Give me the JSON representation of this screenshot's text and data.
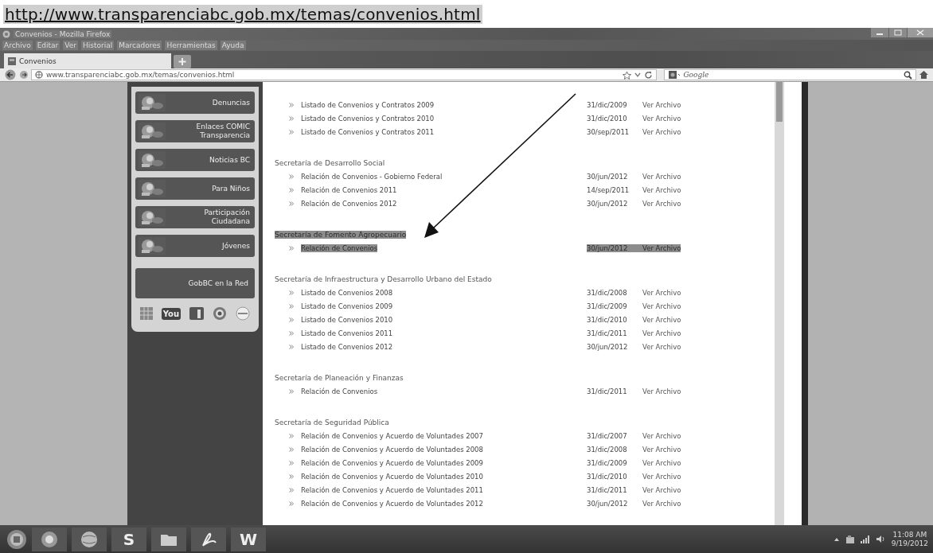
{
  "header_url": "http://www.transparenciabc.gob.mx/temas/convenios.html",
  "window": {
    "title": "Convenios - Mozilla Firefox"
  },
  "menu": [
    "Archivo",
    "Editar",
    "Ver",
    "Historial",
    "Marcadores",
    "Herramientas",
    "Ayuda"
  ],
  "tabs": [
    {
      "label": "Convenios",
      "selected": true
    }
  ],
  "address": "www.transparenciabc.gob.mx/temas/convenios.html",
  "search": {
    "placeholder": "Google"
  },
  "sidebar": {
    "items": [
      {
        "lines": [
          "Denuncias"
        ]
      },
      {
        "lines": [
          "Enlaces COMIC",
          "Transparencia"
        ]
      },
      {
        "lines": [
          "Noticias BC"
        ]
      },
      {
        "lines": [
          "Para Niños"
        ]
      },
      {
        "lines": [
          "Participación",
          "Ciudadana"
        ]
      },
      {
        "lines": [
          "Jóvenes"
        ]
      }
    ],
    "network_heading": "GobBC en la Red",
    "social": [
      {
        "kind": "grid"
      },
      {
        "kind": "video",
        "label": "You"
      },
      {
        "kind": "square"
      },
      {
        "kind": "circle"
      },
      {
        "kind": "disc"
      }
    ]
  },
  "sections": [
    {
      "items": [
        {
          "label": "Listado de Convenios y Contratos 2009",
          "date": "31/dic/2009",
          "link": "Ver Archivo",
          "highlighted": false
        },
        {
          "label": "Listado de Convenios y Contratos 2010",
          "date": "31/dic/2010",
          "link": "Ver Archivo",
          "highlighted": false
        },
        {
          "label": "Listado de Convenios y Contratos 2011",
          "date": "30/sep/2011",
          "link": "Ver Archivo",
          "highlighted": false
        }
      ]
    },
    {
      "title": "Secretaría de Desarrollo Social",
      "highlighted": false,
      "items": [
        {
          "label": "Relación de Convenios - Gobierno Federal",
          "date": "30/jun/2012",
          "link": "Ver Archivo",
          "highlighted": false
        },
        {
          "label": "Relación de Convenios 2011",
          "date": "14/sep/2011",
          "link": "Ver Archivo",
          "highlighted": false
        },
        {
          "label": "Relación de Convenios 2012",
          "date": "30/jun/2012",
          "link": "Ver Archivo",
          "highlighted": false
        }
      ]
    },
    {
      "title": "Secretaría de Fomento Agropecuario",
      "highlighted": true,
      "items": [
        {
          "label": "Relación de Convenios",
          "date": "30/jun/2012",
          "link": "Ver Archivo",
          "highlighted": true
        }
      ]
    },
    {
      "title": "Secretaría de Infraestructura y Desarrollo Urbano del Estado",
      "highlighted": false,
      "items": [
        {
          "label": "Listado de Convenios 2008",
          "date": "31/dic/2008",
          "link": "Ver Archivo",
          "highlighted": false
        },
        {
          "label": "Listado de Convenios 2009",
          "date": "31/dic/2009",
          "link": "Ver Archivo",
          "highlighted": false
        },
        {
          "label": "Listado de Convenios 2010",
          "date": "31/dic/2010",
          "link": "Ver Archivo",
          "highlighted": false
        },
        {
          "label": "Listado de Convenios 2011",
          "date": "31/dic/2011",
          "link": "Ver Archivo",
          "highlighted": false
        },
        {
          "label": "Listado de Convenios 2012",
          "date": "30/jun/2012",
          "link": "Ver Archivo",
          "highlighted": false
        }
      ]
    },
    {
      "title": "Secretaría de Planeación y Finanzas",
      "highlighted": false,
      "items": [
        {
          "label": "Relación de Convenios",
          "date": "31/dic/2011",
          "link": "Ver Archivo",
          "highlighted": false
        }
      ]
    },
    {
      "title": "Secretaría de Seguridad Pública",
      "highlighted": false,
      "items": [
        {
          "label": "Relación de Convenios y Acuerdo de Voluntades 2007",
          "date": "31/dic/2007",
          "link": "Ver Archivo",
          "highlighted": false
        },
        {
          "label": "Relación de Convenios y Acuerdo de Voluntades 2008",
          "date": "31/dic/2008",
          "link": "Ver Archivo",
          "highlighted": false
        },
        {
          "label": "Relación de Convenios y Acuerdo de Voluntades 2009",
          "date": "31/dic/2009",
          "link": "Ver Archivo",
          "highlighted": false
        },
        {
          "label": "Relación de Convenios y Acuerdo de Voluntades 2010",
          "date": "31/dic/2010",
          "link": "Ver Archivo",
          "highlighted": false
        },
        {
          "label": "Relación de Convenios y Acuerdo de Voluntades 2011",
          "date": "31/dic/2011",
          "link": "Ver Archivo",
          "highlighted": false
        },
        {
          "label": "Relación de Convenios y Acuerdo de Voluntades 2012",
          "date": "30/jun/2012",
          "link": "Ver Archivo",
          "highlighted": false
        }
      ]
    }
  ],
  "taskbar": {
    "apps": [
      {
        "kind": "browser"
      },
      {
        "kind": "globe"
      },
      {
        "kind": "letter",
        "label": "S"
      },
      {
        "kind": "folder"
      },
      {
        "kind": "pdf"
      },
      {
        "kind": "letter",
        "label": "W"
      }
    ],
    "time": "11:08 AM",
    "date": "9/19/2012"
  }
}
